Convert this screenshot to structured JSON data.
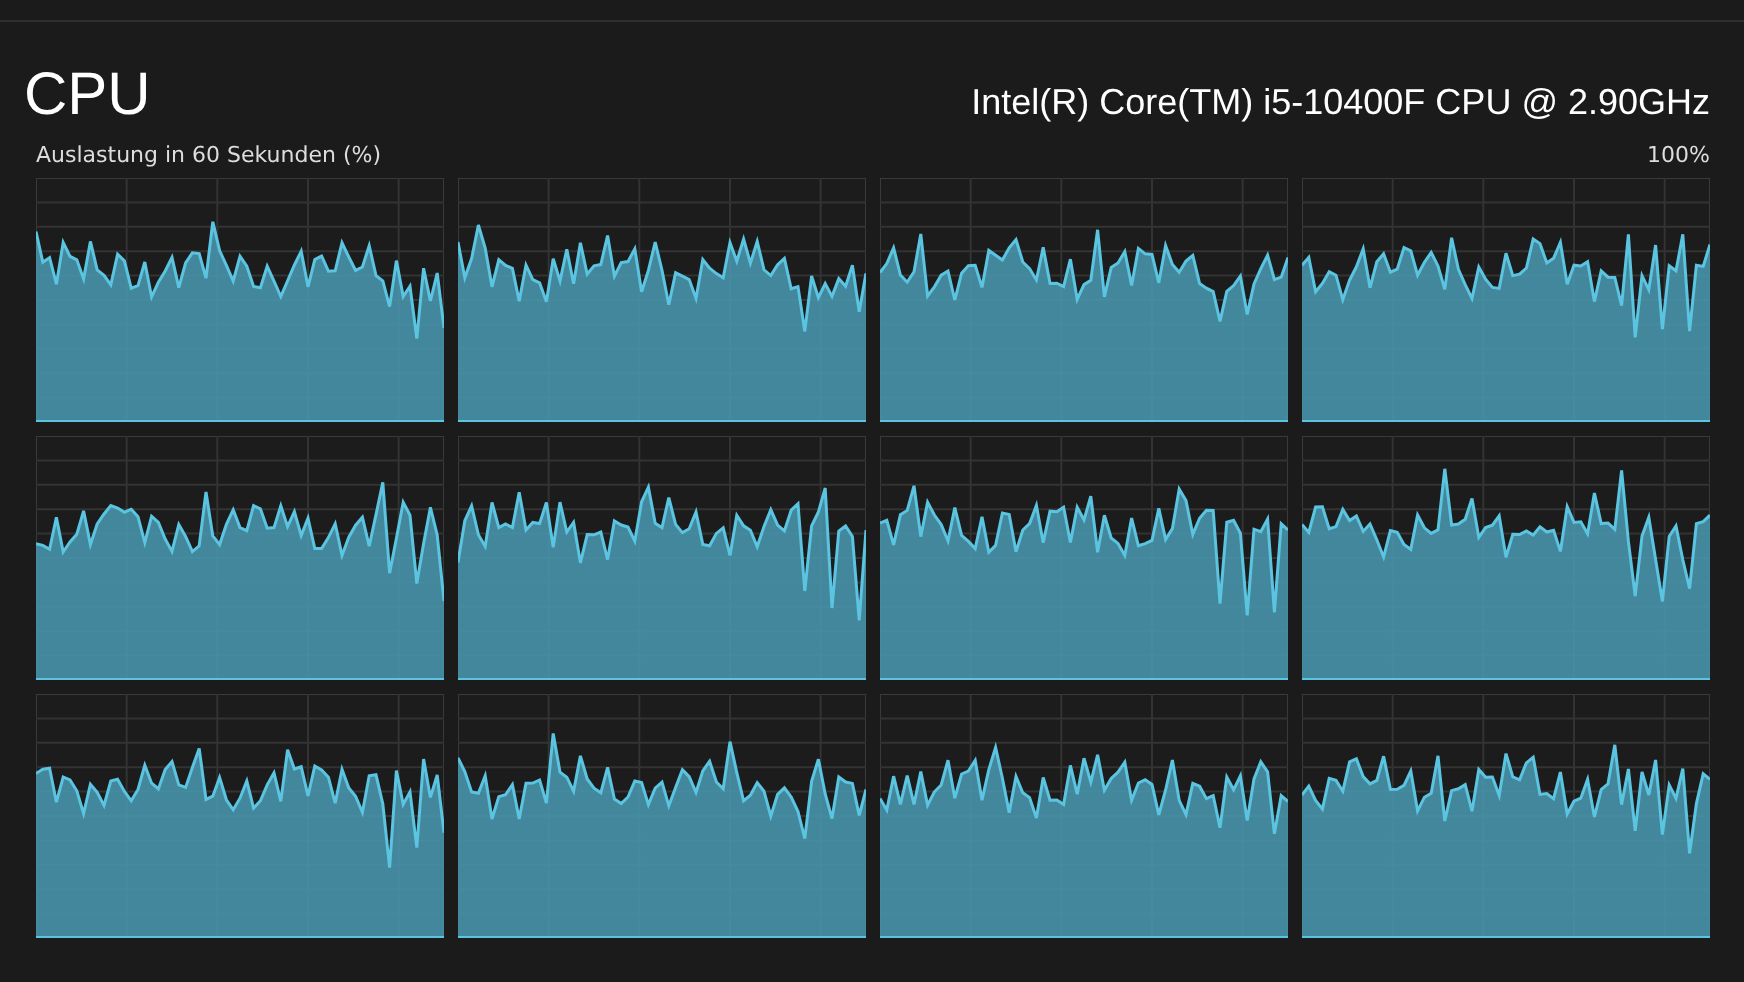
{
  "title": "CPU",
  "processor": "Intel(R) Core(TM) i5-10400F CPU @ 2.90GHz",
  "axis_label": "Auslastung in 60 Sekunden (%)",
  "max_label": "100%",
  "graphs": [
    {
      "kind": "utilization"
    },
    {
      "kind": "utilization"
    },
    {
      "kind": "utilization"
    },
    {
      "kind": "utilization"
    },
    {
      "kind": "utilization"
    },
    {
      "kind": "utilization"
    },
    {
      "kind": "utilization"
    },
    {
      "kind": "utilization"
    },
    {
      "kind": "utilization"
    },
    {
      "kind": "utilization"
    },
    {
      "kind": "utilization"
    },
    {
      "kind": "utilization"
    }
  ]
}
